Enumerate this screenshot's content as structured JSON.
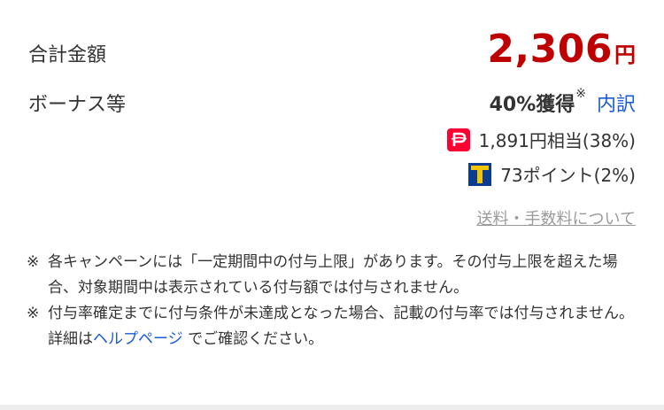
{
  "total": {
    "label": "合計金額",
    "amount": "2,306",
    "unit": "円",
    "accent_color": "#bf0000"
  },
  "bonus": {
    "label": "ボーナス等",
    "rate": "40%獲得",
    "rate_mark": "※",
    "breakdown_link": "内訳",
    "paypay": {
      "icon": "paypay-icon",
      "text": "1,891円相当(38%)",
      "color": "#ff0033"
    },
    "tpoint": {
      "icon": "tpoint-icon",
      "text": "73ポイント(2%)",
      "color": "#0a3d91",
      "accent": "#f5c400"
    }
  },
  "fee_link": "送料・手数料について",
  "notes": [
    {
      "mark": "※",
      "text": "各キャンペーンには「一定期間中の付与上限」があります。その付与上限を超えた場合、対象期間中は表示されている付与額では付与されません。"
    },
    {
      "mark": "※",
      "text_before": "付与率確定までに付与条件が未達成となった場合、記載の付与率では付与されません。詳細は",
      "link": "ヘルプページ",
      "text_after": " でご確認ください。"
    }
  ],
  "link_color": "#1a5bd6"
}
